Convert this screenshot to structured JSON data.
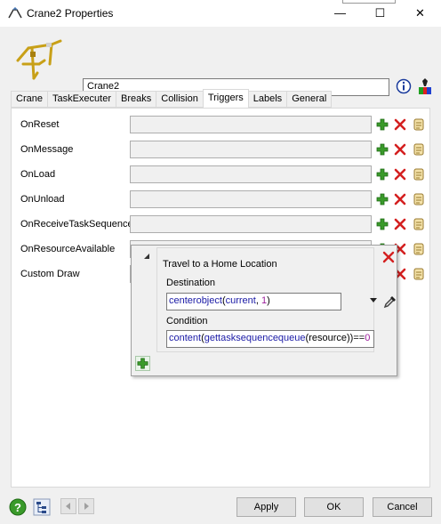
{
  "window": {
    "title": "Crane2  Properties",
    "controls": {
      "minimize": "—",
      "maximize": "☐",
      "close": "✕"
    }
  },
  "header": {
    "object_name": "Crane2"
  },
  "tabs": [
    {
      "label": "Crane",
      "active": false
    },
    {
      "label": "TaskExecuter",
      "active": false
    },
    {
      "label": "Breaks",
      "active": false
    },
    {
      "label": "Collision",
      "active": false
    },
    {
      "label": "Triggers",
      "active": true
    },
    {
      "label": "Labels",
      "active": false
    },
    {
      "label": "General",
      "active": false
    }
  ],
  "triggers": [
    {
      "label": "OnReset"
    },
    {
      "label": "OnMessage"
    },
    {
      "label": "OnLoad"
    },
    {
      "label": "OnUnload"
    },
    {
      "label": "OnReceiveTaskSequence"
    },
    {
      "label": "OnResourceAvailable"
    },
    {
      "label": "Custom Draw"
    }
  ],
  "popup": {
    "title": "Travel to a Home Location",
    "destination_label": "Destination",
    "destination_value": {
      "fn": "centerobject",
      "open": "(",
      "arg1": "current",
      "sep": ", ",
      "num": "1",
      "close": ")"
    },
    "condition_label": "Condition",
    "condition_value": {
      "fn1": "content",
      "p1": "(",
      "fn2": "gettasksequencequeue",
      "p2": "(",
      "arg": "resource",
      "p3": "))==",
      "num": "0"
    }
  },
  "footer": {
    "apply_label": "Apply",
    "ok_label": "OK",
    "cancel_label": "Cancel"
  },
  "colors": {
    "add_green": "#3a9a2a",
    "delete_red": "#d42020",
    "function_blue": "#1a1aa6",
    "number_purple": "#9c1e9c"
  },
  "icons": {
    "trigger_add": "plus-icon",
    "trigger_delete": "x-icon",
    "trigger_code": "scroll-icon"
  }
}
